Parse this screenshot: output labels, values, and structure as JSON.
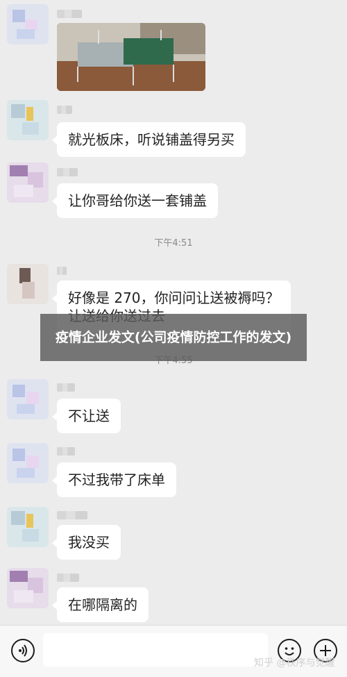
{
  "messages": {
    "m2": {
      "text": "就光板床，听说铺盖得另买"
    },
    "m3": {
      "text": "让你哥给你送一套铺盖"
    },
    "t1": "下午4:51",
    "m4": {
      "line1": "好像是 270，你问问让送被褥吗？",
      "line2": "让送给你送过去"
    },
    "t2": "下午4:55",
    "m5": {
      "text": "不让送"
    },
    "m6": {
      "text": "不过我带了床单"
    },
    "m7": {
      "text": "我没买"
    },
    "m8": {
      "text": "在哪隔离的"
    }
  },
  "overlay": {
    "title": "疫情企业发文(公司疫情防控工作的发文)"
  },
  "watermark": "知乎 @秩序与觉醒",
  "icons": [
    "voice-icon",
    "emoji-icon",
    "add-icon"
  ]
}
